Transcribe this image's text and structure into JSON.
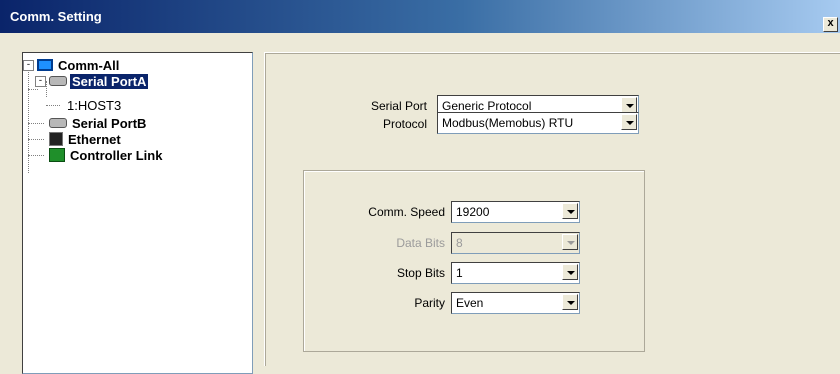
{
  "window": {
    "title": "Comm. Setting",
    "close_label": "x"
  },
  "tree": {
    "root": {
      "label": "Comm-All",
      "expander": "-"
    },
    "serial_a": {
      "label": "Serial PortA",
      "expander": "-"
    },
    "host": {
      "label": "1:HOST3"
    },
    "serial_b": {
      "label": "Serial PortB"
    },
    "ethernet": {
      "label": "Ethernet"
    },
    "controller": {
      "label": "Controller Link"
    }
  },
  "form": {
    "serial_port": {
      "label": "Serial Port",
      "value": "Generic Protocol"
    },
    "protocol": {
      "label": "Protocol",
      "value": "Modbus(Memobus) RTU"
    },
    "comm_speed": {
      "label": "Comm. Speed",
      "value": "19200"
    },
    "data_bits": {
      "label": "Data Bits",
      "value": "8",
      "disabled": true
    },
    "stop_bits": {
      "label": "Stop Bits",
      "value": "1"
    },
    "parity": {
      "label": "Parity",
      "value": "Even"
    }
  },
  "colors": {
    "title_gradient_start": "#0a246a",
    "title_gradient_end": "#a6caf0",
    "selection": "#0a246a",
    "face": "#ece9d8"
  }
}
